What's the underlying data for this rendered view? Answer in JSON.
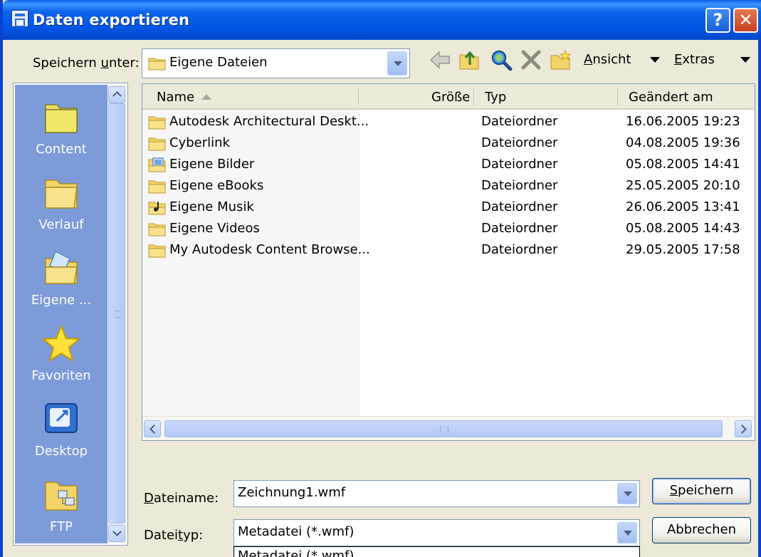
{
  "window": {
    "title": "Daten exportieren"
  },
  "titlebar": {
    "help_label": "?",
    "close_label": "✕"
  },
  "toolbar": {
    "save_in_prefix": "Speichern ",
    "save_in_accel": "u",
    "save_in_suffix": "nter:",
    "location_value": "Eigene Dateien",
    "view_accel": "A",
    "view_rest": "nsicht",
    "tools_accel": "E",
    "tools_rest": "xtras",
    "icons": [
      "back-arrow-icon",
      "up-folder-icon",
      "search-web-icon",
      "delete-icon",
      "new-folder-icon"
    ]
  },
  "places": [
    {
      "label": "Content",
      "icon": "folder-icon"
    },
    {
      "label": "Verlauf",
      "icon": "history-folder-icon"
    },
    {
      "label": "Eigene ...",
      "icon": "my-documents-icon"
    },
    {
      "label": "Favoriten",
      "icon": "star-icon"
    },
    {
      "label": "Desktop",
      "icon": "desktop-icon"
    },
    {
      "label": "FTP",
      "icon": "ftp-icon"
    }
  ],
  "file_list": {
    "columns": [
      "Name",
      "Größe",
      "Typ",
      "Geändert am"
    ],
    "rows": [
      {
        "name": "Autodesk Architectural Deskt...",
        "type": "Dateiordner",
        "modified": "16.06.2005 19:23",
        "icon": "folder-icon"
      },
      {
        "name": "Cyberlink",
        "type": "Dateiordner",
        "modified": "04.08.2005 19:36",
        "icon": "folder-icon"
      },
      {
        "name": "Eigene Bilder",
        "type": "Dateiordner",
        "modified": "05.08.2005 14:41",
        "icon": "pictures-folder-icon"
      },
      {
        "name": "Eigene eBooks",
        "type": "Dateiordner",
        "modified": "25.05.2005 20:10",
        "icon": "folder-icon"
      },
      {
        "name": "Eigene Musik",
        "type": "Dateiordner",
        "modified": "26.06.2005 13:41",
        "icon": "music-folder-icon"
      },
      {
        "name": "Eigene Videos",
        "type": "Dateiordner",
        "modified": "05.08.2005 14:43",
        "icon": "folder-icon"
      },
      {
        "name": "My Autodesk Content Browse...",
        "type": "Dateiordner",
        "modified": "29.05.2005 17:58",
        "icon": "folder-icon"
      }
    ]
  },
  "form": {
    "filename_accel": "D",
    "filename_rest": "ateiname:",
    "filename_value": "Zeichnung1.wmf",
    "filetype_prefix": "Datei",
    "filetype_accel": "t",
    "filetype_rest": "yp:",
    "filetype_value": "Metadatei (*.wmf)",
    "filetype_option": "Metadatei (*.wmf)",
    "save_accel": "S",
    "save_rest": "peichern",
    "cancel_label": "Abbrechen"
  },
  "colors": {
    "titlebar": "#0055E5",
    "places_bg": "#7D9BD9",
    "dialog_bg": "#ECE9D8",
    "folder_yellow": "#F2D566"
  }
}
